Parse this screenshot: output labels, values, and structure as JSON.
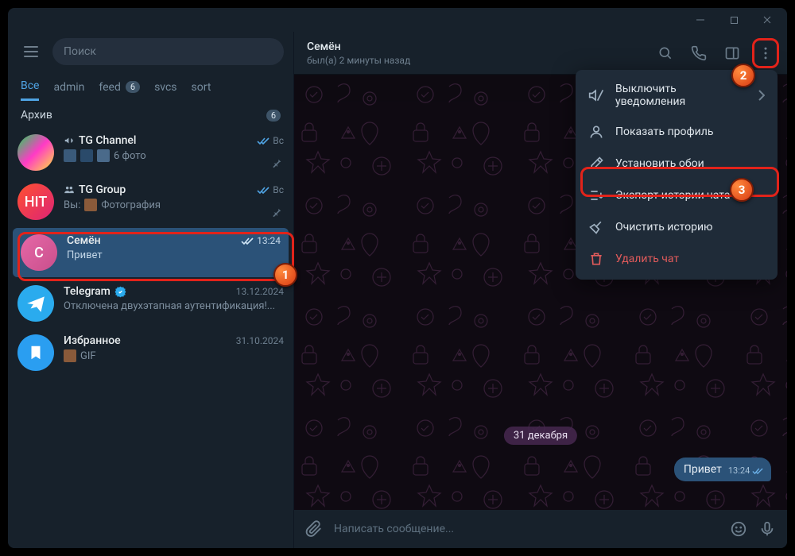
{
  "titlebar": {
    "min": "—",
    "max": "□",
    "close": "×"
  },
  "search": {
    "placeholder": "Поиск"
  },
  "tabs": [
    {
      "label": "Все",
      "active": true
    },
    {
      "label": "admin"
    },
    {
      "label": "feed",
      "badge": "6"
    },
    {
      "label": "svcs"
    },
    {
      "label": "sort"
    }
  ],
  "archive": {
    "label": "Архив",
    "badge": "6"
  },
  "chats": [
    {
      "name": "TG Channel",
      "sub": "6 фото",
      "time": "Вс",
      "prefix_icon": "megaphone",
      "thumbs": true,
      "pin": true,
      "avatar_bg": "linear-gradient(135deg,#1fd655,#ff3ac6,#ffe53b)",
      "checks": true
    },
    {
      "name": "TG Group",
      "sub": "Фотография",
      "sub_prefix": "Вы:",
      "time": "Вс",
      "prefix_icon": "group",
      "pin": true,
      "avatar_bg": "linear-gradient(135deg,#ff512f,#dd2476)",
      "avatar_text": "HIT",
      "thumb_one": true,
      "checks": true
    },
    {
      "name": "Семён",
      "sub": "Привет",
      "time": "13:24",
      "selected": true,
      "avatar_bg": "linear-gradient(135deg,#e668a7,#c94f8c)",
      "avatar_text": "С",
      "checks": true
    },
    {
      "name": "Telegram",
      "sub": "Отключена двухэтапная аутентификация!...",
      "time": "13.12.2024",
      "avatar_bg": "#2aabee",
      "avatar_svg": "plane",
      "verified": true
    },
    {
      "name": "Избранное",
      "sub": "GIF",
      "time": "31.10.2024",
      "avatar_bg": "#2a9ef1",
      "avatar_svg": "bookmark",
      "thumb_one": true
    }
  ],
  "chat_header": {
    "title": "Семён",
    "status": "был(а) 2 минуты назад"
  },
  "date_chip": "31 декабря",
  "msg": {
    "text": "Привет",
    "time": "13:24"
  },
  "composer": {
    "placeholder": "Написать сообщение..."
  },
  "menu": [
    {
      "label": "Выключить уведомления",
      "icon": "mute",
      "chevron": true
    },
    {
      "label": "Показать профиль",
      "icon": "profile"
    },
    {
      "label": "Установить обои",
      "icon": "brush"
    },
    {
      "label": "Экспорт истории чата",
      "icon": "export",
      "highlight": true
    },
    {
      "label": "Очистить историю",
      "icon": "broom"
    },
    {
      "label": "Удалить чат",
      "icon": "trash",
      "danger": true
    }
  ],
  "annotations": {
    "step1": "1",
    "step2": "2",
    "step3": "3"
  }
}
